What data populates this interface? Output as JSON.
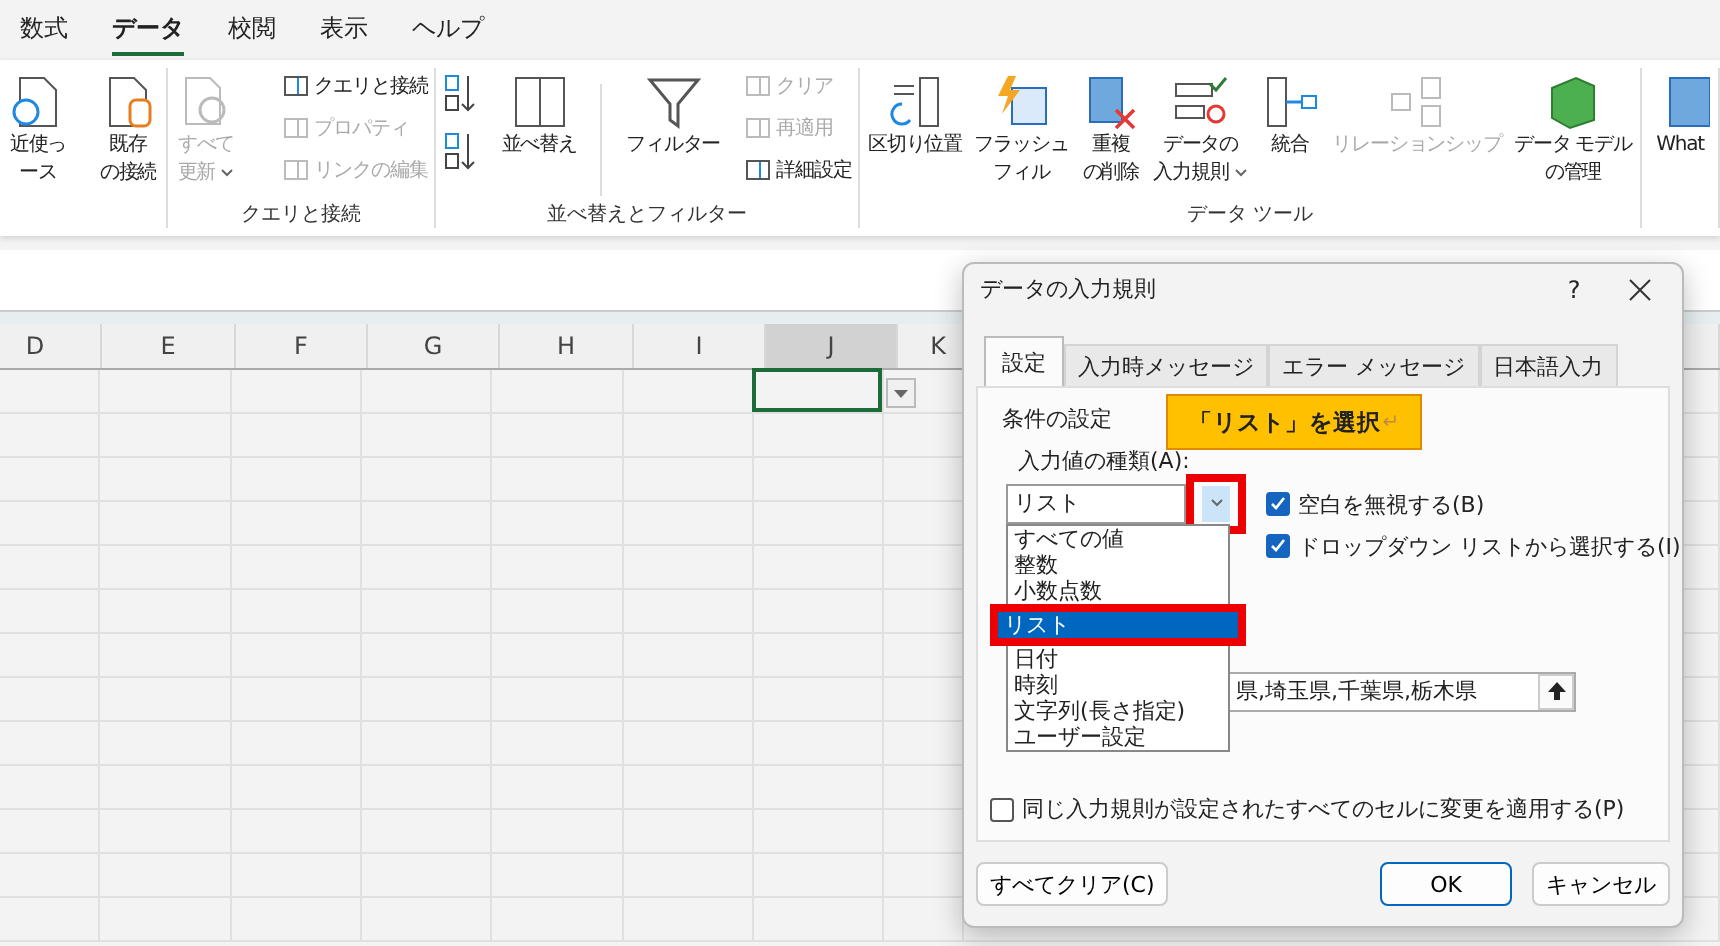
{
  "ribbon_tabs": [
    {
      "label": "数式",
      "selected": false
    },
    {
      "label": "データ",
      "selected": true
    },
    {
      "label": "校閲",
      "selected": false
    },
    {
      "label": "表示",
      "selected": false
    },
    {
      "label": "ヘルプ",
      "selected": false
    }
  ],
  "ribbon_groups": [
    {
      "items": [
        {
          "kind": "large",
          "lines": [
            "近使っ",
            "ース"
          ],
          "disabled": false,
          "menu": false
        },
        {
          "kind": "large",
          "lines": [
            "既存",
            "の接続"
          ],
          "disabled": false,
          "menu": false
        }
      ]
    },
    {
      "label": "クエリと接続",
      "items": [
        {
          "kind": "large",
          "lines": [
            "すべて",
            "更新"
          ],
          "disabled": true,
          "menu": true
        },
        {
          "kind": "stack",
          "entries": [
            {
              "label": "クエリと接続",
              "disabled": false
            },
            {
              "label": "プロパティ",
              "disabled": true
            },
            {
              "label": "リンクの編集",
              "disabled": true
            }
          ]
        }
      ]
    },
    {
      "label": "並べ替えとフィルター",
      "items": [
        {
          "kind": "sortpair"
        },
        {
          "kind": "large",
          "lines": [
            "並べ替え"
          ],
          "disabled": false,
          "menu": false
        },
        {
          "kind": "separator"
        },
        {
          "kind": "large",
          "lines": [
            "フィルター"
          ],
          "disabled": false,
          "menu": false
        },
        {
          "kind": "stack",
          "entries": [
            {
              "label": "クリア",
              "disabled": true
            },
            {
              "label": "再適用",
              "disabled": true
            },
            {
              "label": "詳細設定",
              "disabled": false
            }
          ]
        }
      ]
    },
    {
      "label": "データ ツール",
      "items": [
        {
          "kind": "large",
          "lines": [
            "区切り位置"
          ],
          "disabled": false,
          "menu": false
        },
        {
          "kind": "large",
          "lines": [
            "フラッシュ",
            "フィル"
          ],
          "disabled": false,
          "menu": false
        },
        {
          "kind": "large",
          "lines": [
            "重複",
            "の削除"
          ],
          "disabled": false,
          "menu": false
        },
        {
          "kind": "large",
          "lines": [
            "データの",
            "入力規則"
          ],
          "disabled": false,
          "menu": true
        },
        {
          "kind": "large",
          "lines": [
            "統合"
          ],
          "disabled": false,
          "menu": false
        },
        {
          "kind": "large",
          "lines": [
            "リレーションシップ"
          ],
          "disabled": true,
          "menu": false
        },
        {
          "kind": "large",
          "lines": [
            "データ モデル",
            "の管理"
          ],
          "disabled": false,
          "menu": false
        }
      ]
    },
    {
      "items": [
        {
          "kind": "large",
          "lines": [
            "What"
          ],
          "disabled": false,
          "menu": false
        }
      ]
    }
  ],
  "sheet": {
    "columns": [
      {
        "label": "D",
        "selected": false
      },
      {
        "label": "E",
        "selected": false
      },
      {
        "label": "F",
        "selected": false
      },
      {
        "label": "G",
        "selected": false
      },
      {
        "label": "H",
        "selected": false
      },
      {
        "label": "I",
        "selected": false
      },
      {
        "label": "J",
        "selected": true
      },
      {
        "label": "K",
        "selected": false
      }
    ],
    "active_cell": {
      "list_arrow": true
    }
  },
  "dialog": {
    "title": "データの入力規則",
    "help": "?",
    "tabs": [
      {
        "label": "設定",
        "selected": true
      },
      {
        "label": "入力時メッセージ",
        "selected": false
      },
      {
        "label": "エラー メッセージ",
        "selected": false
      },
      {
        "label": "日本語入力",
        "selected": false
      }
    ],
    "section": "条件の設定",
    "type_label": "入力値の種類(A):",
    "type_value": "リスト",
    "checks": [
      {
        "label": "空白を無視する(B)",
        "checked": true
      },
      {
        "label": "ドロップダウン リストから選択する(I)",
        "checked": true
      }
    ],
    "options": [
      {
        "label": "すべての値",
        "selected": false
      },
      {
        "label": "整数",
        "selected": false
      },
      {
        "label": "小数点数",
        "selected": false
      },
      {
        "label": "リスト",
        "selected": true
      },
      {
        "label": "日付",
        "selected": false
      },
      {
        "label": "時刻",
        "selected": false
      },
      {
        "label": "文字列(長さ指定)",
        "selected": false
      },
      {
        "label": "ユーザー設定",
        "selected": false
      }
    ],
    "source_value": "県,埼玉県,千葉県,栃木県",
    "apply_all": {
      "label": "同じ入力規則が設定されたすべてのセルに変更を適用する(P)",
      "checked": false
    },
    "buttons": [
      "すべてクリア(C)",
      "OK",
      "キャンセル"
    ]
  },
  "callout": {
    "text": "「リスト」を選択",
    "mark": "↵"
  }
}
